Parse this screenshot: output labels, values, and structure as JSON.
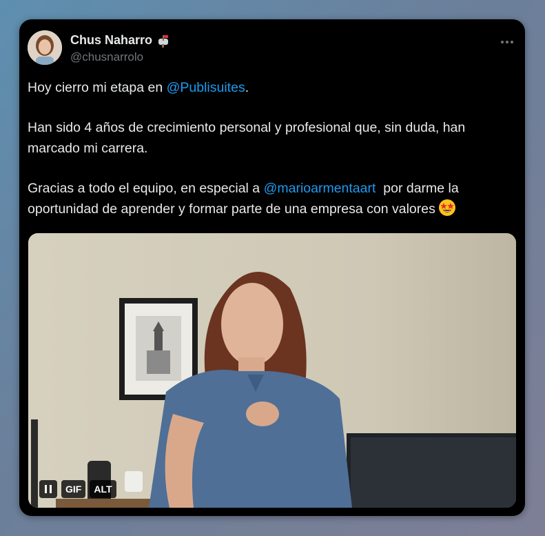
{
  "tweet": {
    "author_name": "Chus Naharro",
    "author_handle": "@chusnarrolo",
    "line1_before": "Hoy cierro mi etapa en ",
    "mention1": "@Publisuites",
    "line1_after": ".",
    "paragraph2": "Han sido 4 años de crecimiento personal y profesional que, sin duda, han marcado mi carrera.",
    "para3_before": "Gracias a todo el equipo, en especial a ",
    "mention2": "@marioarmentaart",
    "para3_after": "  por darme la oportunidad de aprender y formar parte de una empresa con valores"
  },
  "media": {
    "gif_label": "GIF",
    "alt_label": "ALT"
  },
  "icons": {
    "badge": "mailbox-icon",
    "menu": "more-icon",
    "emoji": "star-struck-emoji",
    "media_control": "pause-icon"
  },
  "colors": {
    "card_background": "#000000",
    "text": "#e7e9ea",
    "secondary_text": "#71767b",
    "link": "#1d9bf0"
  }
}
